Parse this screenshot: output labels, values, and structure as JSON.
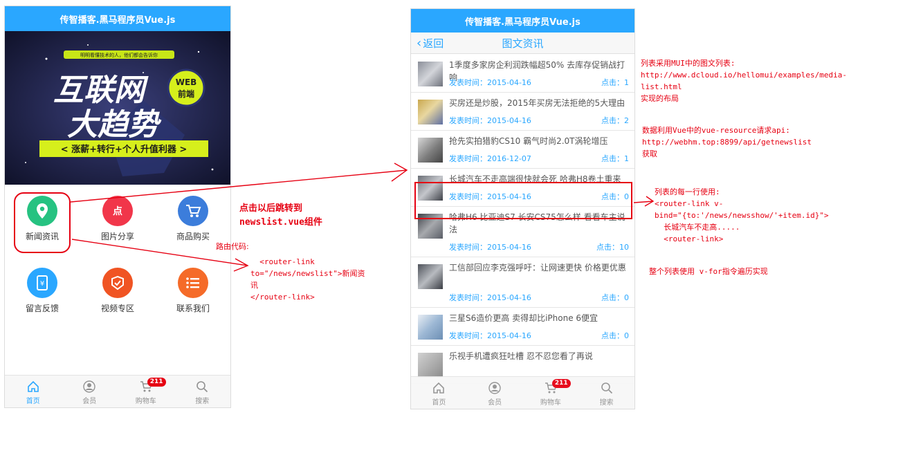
{
  "left_phone": {
    "header_title": "传智播客.黑马程序员Vue.js",
    "banner": {
      "tagline": "明明看懂技术的人，他们都会告诉你",
      "title_line1": "互联网",
      "title_line2": "大趋势",
      "badge_line1": "WEB",
      "badge_line2": "前端",
      "slogan": "< 涨薪+转行+个人升值利器 >"
    },
    "grid": [
      {
        "label": "新闻资讯",
        "icon": "location-pin-icon",
        "color": "#26c281"
      },
      {
        "label": "图片分享",
        "icon": "photo-share-icon",
        "color": "#f1364a"
      },
      {
        "label": "商品购买",
        "icon": "shopping-cart-icon",
        "color": "#3c7ddb"
      },
      {
        "label": "留言反馈",
        "icon": "feedback-icon",
        "color": "#2aa7ff"
      },
      {
        "label": "视频专区",
        "icon": "video-icon",
        "color": "#f05423"
      },
      {
        "label": "联系我们",
        "icon": "contact-list-icon",
        "color": "#f56b29"
      }
    ],
    "tabs": [
      {
        "label": "首页",
        "icon": "home-icon"
      },
      {
        "label": "会员",
        "icon": "member-icon"
      },
      {
        "label": "购物车",
        "icon": "cart-icon",
        "badge": "211"
      },
      {
        "label": "搜索",
        "icon": "search-icon"
      }
    ]
  },
  "right_phone": {
    "header_title": "传智播客.黑马程序员Vue.js",
    "back_label": "返回",
    "nav_title": "图文资讯",
    "news": [
      {
        "title": "1季度多家房企利润跌幅超50% 去库存促销战打响",
        "time": "发表时间：2015-04-16",
        "clicks": "点击：1"
      },
      {
        "title": "买房还是炒股，2015年买房无法拒绝的5大理由",
        "time": "发表时间：2015-04-16",
        "clicks": "点击：2"
      },
      {
        "title": "抢先实拍猎豹CS10 霸气时尚2.0T涡轮增压",
        "time": "发表时间：2016-12-07",
        "clicks": "点击：1"
      },
      {
        "title": "长城汽车不走高端很快就会死 哈弗H8卷土重来",
        "time": "发表时间：2015-04-16",
        "clicks": "点击：0"
      },
      {
        "title": "哈弗H6 比亚迪S7 长安CS75怎么样 看看车主说法",
        "time": "发表时间：2015-04-16",
        "clicks": "点击：10"
      },
      {
        "title": "工信部回应李克强呼吁：让网速更快 价格更优惠",
        "time": "发表时间：2015-04-16",
        "clicks": "点击：0"
      },
      {
        "title": "三星S6造价更高 卖得却比iPhone 6便宜",
        "time": "发表时间：2015-04-16",
        "clicks": "点击：0"
      },
      {
        "title": "乐视手机遭疯狂吐槽 忍不忍您看了再说",
        "time": "",
        "clicks": ""
      }
    ],
    "tabs": [
      {
        "label": "首页",
        "icon": "home-icon"
      },
      {
        "label": "会员",
        "icon": "member-icon"
      },
      {
        "label": "购物车",
        "icon": "cart-icon",
        "badge": "211"
      },
      {
        "label": "搜索",
        "icon": "search-icon"
      }
    ]
  },
  "annotations": {
    "jump_note": "点击以后跳转到\nnewslist.vue组件",
    "route_title": "路由代码:",
    "route_code": "  <router-link\nto=\"/news/newslist\">新闻资\n讯\n</router-link>",
    "list_note": "列表采用MUI中的图文列表:\nhttp://www.dcloud.io/hellomui/examples/media-\nlist.html\n实现的布局",
    "data_note": "数据利用Vue中的vue-resource请求api:\nhttp://webhm.top:8899/api/getnewslist\n获取",
    "row_note": "列表的每一行使用:\n<router-link v-\nbind=\"{to:'/news/newsshow/'+item.id}\">\n  长城汽车不走高.....\n  <router-link>",
    "vfor_note": "整个列表使用 v-for指令遍历实现"
  },
  "colors": {
    "accent": "#2aa7ff",
    "annotation": "#e60012",
    "badge": "#e60012"
  }
}
